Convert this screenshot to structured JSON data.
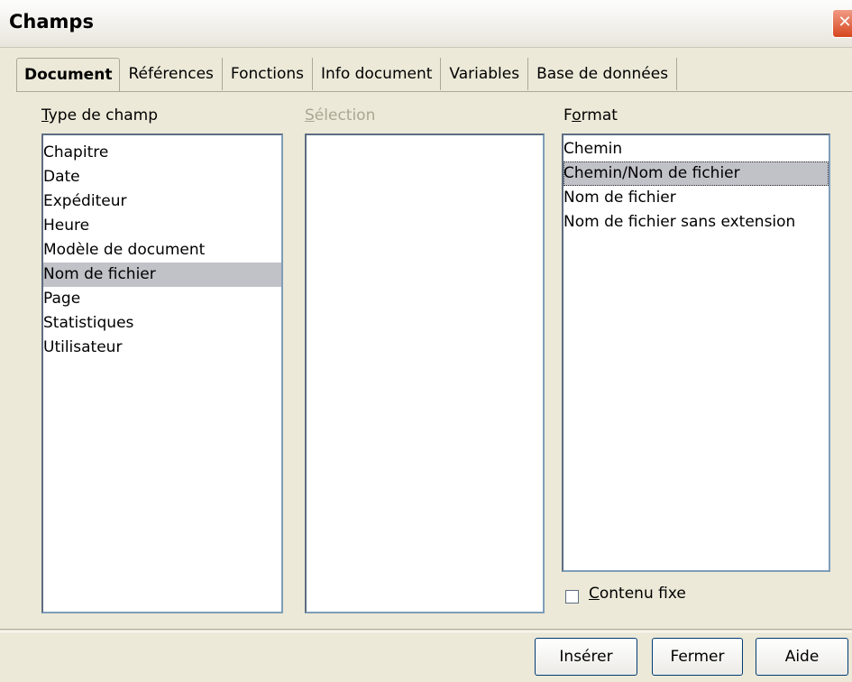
{
  "window": {
    "title": "Champs",
    "close_icon": "close-icon"
  },
  "tabs": [
    {
      "label": "Document",
      "active": true
    },
    {
      "label": "Références"
    },
    {
      "label": "Fonctions"
    },
    {
      "label": "Info document"
    },
    {
      "label": "Variables"
    },
    {
      "label": "Base de données"
    }
  ],
  "type_de_champ": {
    "label_first": "T",
    "label_rest": "ype de champ",
    "items": [
      "Chapitre",
      "Date",
      "Expéditeur",
      "Heure",
      "Modèle de document",
      "Nom de fichier",
      "Page",
      "Statistiques",
      "Utilisateur"
    ],
    "selected": "Nom de fichier"
  },
  "selection": {
    "label_first": "S",
    "label_rest": "élection"
  },
  "format": {
    "label_first": "F",
    "label_u": "o",
    "label_rest": "rmat",
    "items": [
      "Chemin",
      "Chemin/Nom de fichier",
      "Nom de fichier",
      "Nom de fichier sans extension"
    ],
    "selected": "Chemin/Nom de fichier"
  },
  "contenu_fixe": {
    "label_u": "C",
    "label_rest": "ontenu fixe",
    "checked": false
  },
  "buttons": {
    "insert": "Insérer",
    "close": "Fermer",
    "help": "Aide"
  }
}
